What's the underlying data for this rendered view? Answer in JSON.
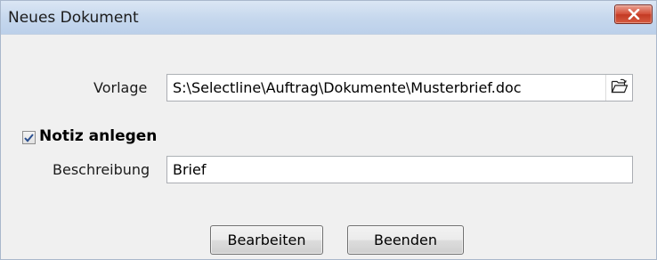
{
  "window": {
    "title": "Neues Dokument",
    "close_icon": "close-icon"
  },
  "vorlage": {
    "label": "Vorlage",
    "value": "S:\\Selectline\\Auftrag\\Dokumente\\Musterbrief.doc",
    "browse_icon": "folder-open-icon"
  },
  "notiz": {
    "checked": true,
    "label": "Notiz anlegen"
  },
  "beschreibung": {
    "label": "Beschreibung",
    "value": "Brief"
  },
  "buttons": {
    "edit_label": "Bearbeiten",
    "close_label": "Beenden"
  }
}
